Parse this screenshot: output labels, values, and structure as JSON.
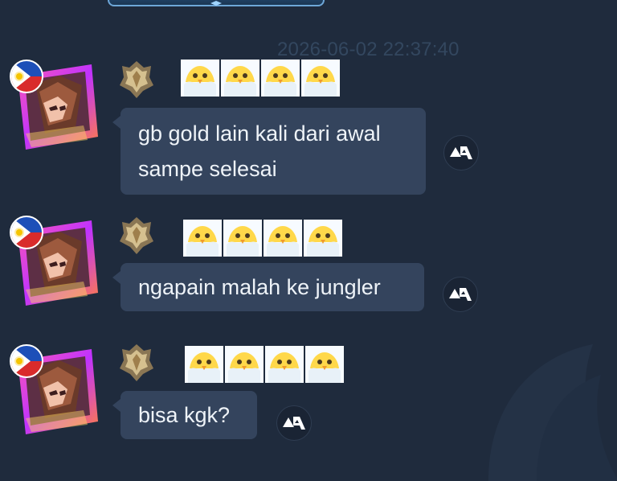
{
  "chat": {
    "timestamp": "2026-06-02 22:37:40",
    "messages": [
      {
        "lines": [
          "gb gold lain kali dari awal",
          "sampe selesai"
        ],
        "avatar_icon": "hero-avatar-icon",
        "flag_icon": "philippines-flag-icon",
        "rank_icon": "gold-rank-badge-icon",
        "emblem_icon": "chick-emblem-icon",
        "emblem_count": 4
      },
      {
        "lines": [
          "ngapain malah ke jungler"
        ],
        "avatar_icon": "hero-avatar-icon",
        "flag_icon": "philippines-flag-icon",
        "rank_icon": "gold-rank-badge-icon",
        "emblem_icon": "chick-emblem-icon",
        "emblem_count": 4
      },
      {
        "lines": [
          "bisa kgk?"
        ],
        "avatar_icon": "hero-avatar-icon",
        "flag_icon": "philippines-flag-icon",
        "rank_icon": "gold-rank-badge-icon",
        "emblem_icon": "chick-emblem-icon",
        "emblem_count": 4
      }
    ]
  },
  "colors": {
    "background": "#1f2b3d",
    "bubble": "#34445d",
    "timestamp": "#33475f",
    "text": "#eef3f8"
  }
}
